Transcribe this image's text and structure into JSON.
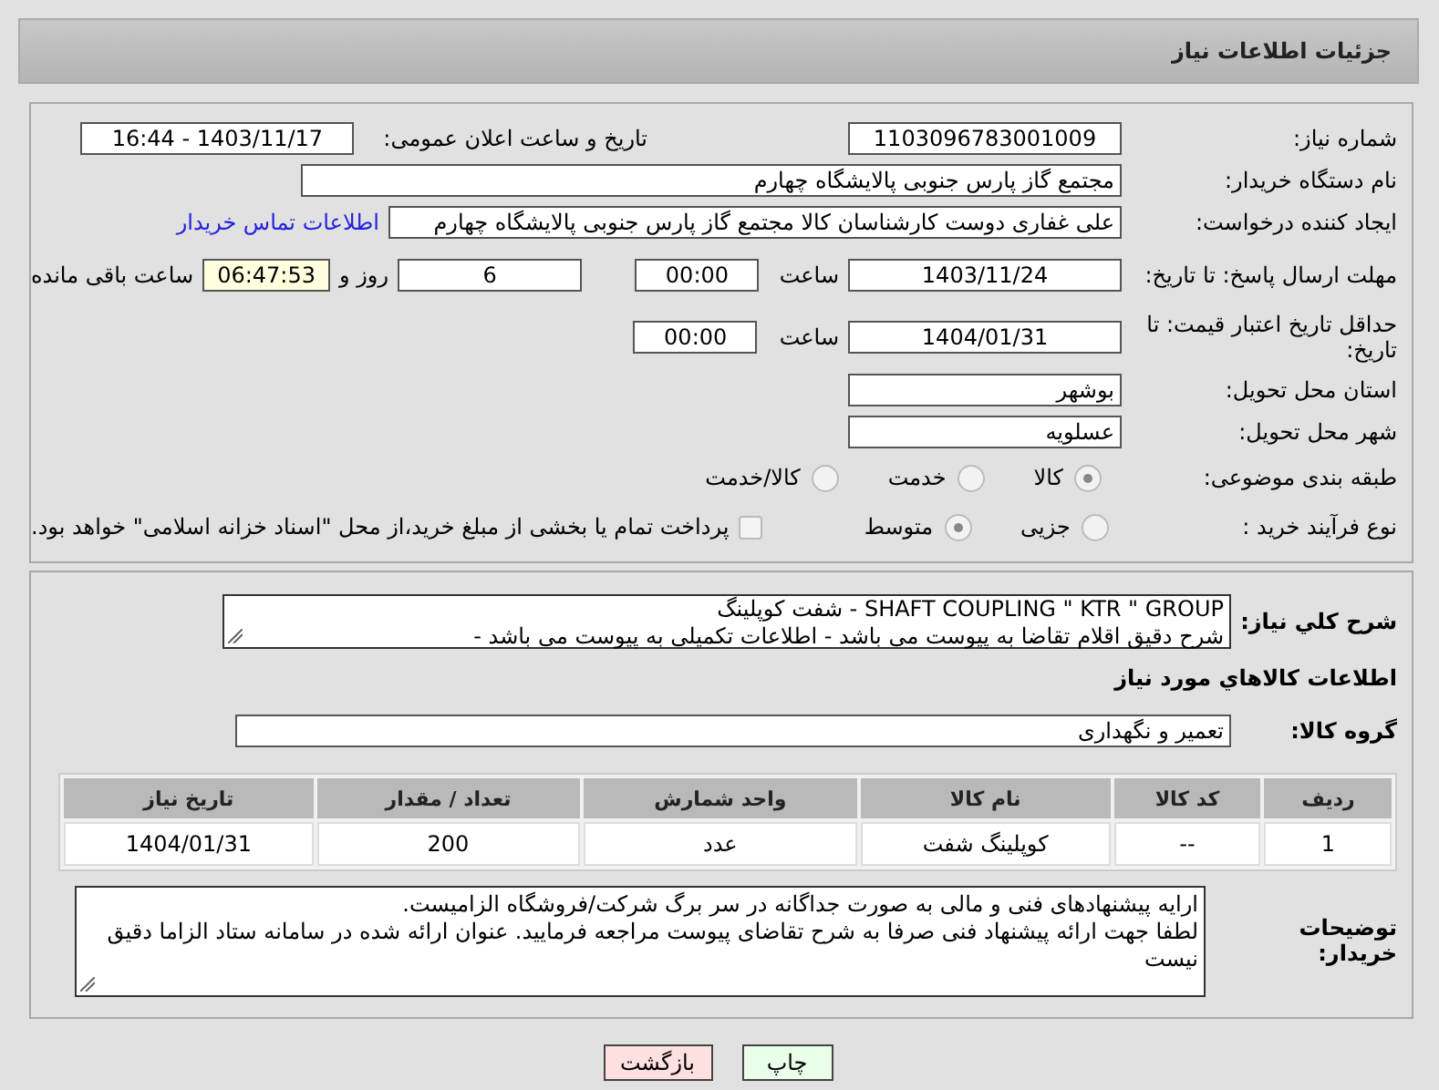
{
  "header": {
    "title": "جزئیات اطلاعات نیاز"
  },
  "need_number": {
    "label": "شماره نیاز:",
    "value": "1103096783001009"
  },
  "announce": {
    "label": "تاریخ و ساعت اعلان عمومی:",
    "value": "1403/11/17 - 16:44"
  },
  "buyer_org": {
    "label": "نام دستگاه خریدار:",
    "value": "مجتمع گاز پارس جنوبی  پالایشگاه چهارم"
  },
  "requester": {
    "label": "ایجاد کننده درخواست:",
    "value": "علی غفاری دوست کارشناسان کالا مجتمع گاز پارس جنوبی  پالایشگاه چهارم",
    "link": "اطلاعات تماس خریدار"
  },
  "reply_deadline": {
    "label": "مهلت ارسال پاسخ: تا تاریخ:",
    "date": "1403/11/24",
    "time_label": "ساعت",
    "time": "00:00",
    "days": "6",
    "days_label": "روز و",
    "remaining": "06:47:53",
    "remaining_label": "ساعت باقی مانده"
  },
  "price_validity": {
    "label": "حداقل تاریخ اعتبار قیمت: تا تاریخ:",
    "date": "1404/01/31",
    "time_label": "ساعت",
    "time": "00:00"
  },
  "province": {
    "label": "استان محل تحویل:",
    "value": "بوشهر"
  },
  "city": {
    "label": "شهر محل تحویل:",
    "value": "عسلویه"
  },
  "category": {
    "label": "طبقه بندی موضوعی:",
    "options": [
      {
        "label": "کالا",
        "selected": true
      },
      {
        "label": "خدمت",
        "selected": false
      },
      {
        "label": "کالا/خدمت",
        "selected": false
      }
    ]
  },
  "purchase_process": {
    "label": "نوع فرآیند خرید :",
    "options": [
      {
        "label": "جزیی",
        "selected": false
      },
      {
        "label": "متوسط",
        "selected": true
      }
    ],
    "payment": {
      "label": "پرداخت تمام یا بخشی از مبلغ خرید،از محل \"اسناد خزانه اسلامی\" خواهد بود.",
      "checked": false
    }
  },
  "description": {
    "label": "شرح کلي نياز:",
    "lines": [
      "SHAFT COUPLING \" KTR \" GROUP - شفت کوپلینگ",
      "شرح دقیق اقلام تقاضا به پیوست می باشد - اطلاعات تکمیلی به پیوست می باشد -"
    ]
  },
  "goods_heading": "اطلاعات کالاهاي مورد نياز",
  "goods_group": {
    "label": "گروه کالا:",
    "value": "تعمیر و نگهداری"
  },
  "table": {
    "columns": [
      "ردیف",
      "کد کالا",
      "نام کالا",
      "واحد شمارش",
      "تعداد / مقدار",
      "تاریخ نیاز"
    ],
    "rows": [
      [
        "1",
        "--",
        "کوپلینگ شفت",
        "عدد",
        "200",
        "1404/01/31"
      ]
    ]
  },
  "buyer_notes": {
    "label": "توضیحات خریدار:",
    "lines": [
      "ارایه پیشنهادهای فنی و مالی به صورت جداگانه در سر برگ شرکت/فروشگاه الزامیست.",
      "لطفا جهت ارائه پیشنهاد فنی صرفا به شرح تقاضای پیوست مراجعه فرمایید. عنوان ارائه شده در سامانه ستاد الزاما دقیق نیست"
    ]
  },
  "buttons": [
    {
      "label": "چاپ",
      "kind": "print"
    },
    {
      "label": "بازگشت",
      "kind": "back"
    }
  ]
}
